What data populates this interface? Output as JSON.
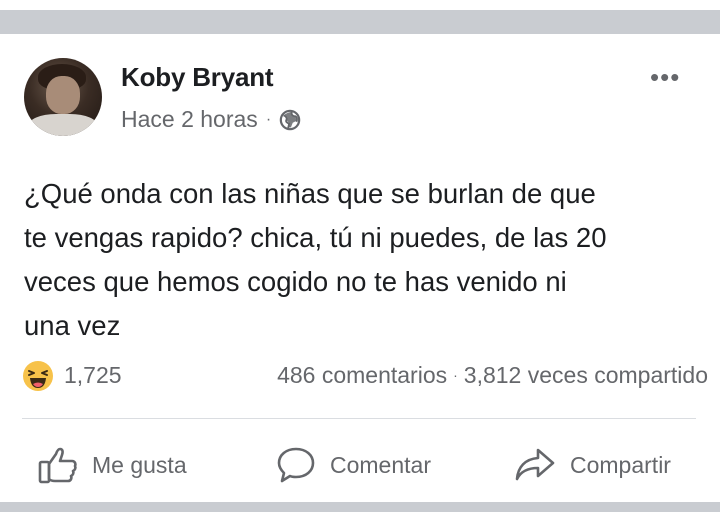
{
  "post": {
    "author": "Koby Bryant",
    "timestamp": "Hace 2 horas",
    "separator": "·",
    "privacy_icon": "globe-icon",
    "more_icon": "ellipsis-icon",
    "more_label": "•••",
    "text_lines": [
      "¿Qué onda con las niñas que se burlan de que",
      "te vengas rapido? chica, tú ni puedes, de las 20",
      "veces que hemos cogido no te has venido ni",
      "una vez"
    ]
  },
  "stats": {
    "reaction_icon": "haha-emoji-icon",
    "reactions_count": "1,725",
    "comments": "486 comentarios",
    "separator": "·",
    "shares": "3,812 veces compartido"
  },
  "actions": {
    "like_label": "Me gusta",
    "comment_label": "Comentar",
    "share_label": "Compartir"
  },
  "colors": {
    "text_primary": "#1c1e21",
    "text_secondary": "#65676b",
    "page_background": "#c9ccd1",
    "haha_yellow": "#f7c24a"
  }
}
